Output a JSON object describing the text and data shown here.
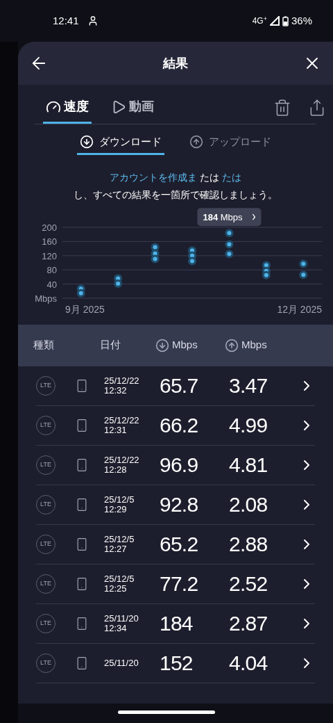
{
  "status_bar": {
    "time": "12:41",
    "network": "4G$^{+}$",
    "battery": "36%"
  },
  "header": {
    "title": "結果"
  },
  "tabs": [
    {
      "label": "速度",
      "kind": "gauge",
      "selected": true
    },
    {
      "label": "動画",
      "kind": "play",
      "selected": false
    }
  ],
  "direction_tabs": [
    {
      "label": "ダウンロード",
      "kind": "down",
      "selected": true
    },
    {
      "label": "アップロード",
      "kind": "up",
      "selected": false
    }
  ],
  "promo": {
    "lines": [
      [
        {
          "text": "アカウントを作成ま",
          "link": true
        },
        {
          "text": "たは",
          "link": false
        },
        {
          "text": "たは",
          "link": true
        }
      ],
      [
        {
          "text": "し、すべての結果を一箇所で確認しましょう。",
          "link": false
        }
      ]
    ]
  },
  "chart_data": {
    "type": "scatter",
    "ylabel": "Mbps",
    "ylim": [
      0,
      200
    ],
    "grid": true,
    "categories": [
      "9月 2025",
      null,
      null,
      null,
      null,
      null,
      "12月 2025"
    ],
    "yticks": [
      40,
      80,
      120,
      160,
      200
    ],
    "series": [
      {
        "color": "#4fb3e8",
        "values": [
          27,
          56,
          144,
          135,
          184,
          93,
          97
        ]
      },
      {
        "color": "#4fb3e8",
        "values": [
          14,
          41,
          126,
          120,
          152,
          77,
          66
        ]
      },
      {
        "color": "#4fb3e8",
        "values": [
          null,
          null,
          111,
          105,
          125,
          65,
          null
        ]
      }
    ],
    "annotations": [
      "**184** Mbps"
    ]
  },
  "table": {
    "columns": [
      {
        "label": "種類",
        "kind": "text"
      },
      {
        "label": "日付",
        "kind": "text"
      },
      {
        "label": "Mbps",
        "kind": "down"
      },
      {
        "label": "Mbps",
        "kind": "up"
      }
    ],
    "rows": [
      {
        "type": "LTE",
        "date": "25/12/22",
        "time": "12:32",
        "download": "65.7",
        "upload": "3.47"
      },
      {
        "type": "LTE",
        "date": "25/12/22",
        "time": "12:31",
        "download": "66.2",
        "upload": "4.99"
      },
      {
        "type": "LTE",
        "date": "25/12/22",
        "time": "12:28",
        "download": "96.9",
        "upload": "4.81"
      },
      {
        "type": "LTE",
        "date": "25/12/5",
        "time": "12:29",
        "download": "92.8",
        "upload": "2.08"
      },
      {
        "type": "LTE",
        "date": "25/12/5",
        "time": "12:27",
        "download": "65.2",
        "upload": "2.88"
      },
      {
        "type": "LTE",
        "date": "25/12/5",
        "time": "12:25",
        "download": "77.2",
        "upload": "2.52"
      },
      {
        "type": "LTE",
        "date": "25/11/20",
        "time": "12:34",
        "download": "184",
        "upload": "2.87"
      },
      {
        "type": "LTE",
        "date": "25/11/20",
        "download": "152",
        "upload": "4.04"
      }
    ]
  }
}
